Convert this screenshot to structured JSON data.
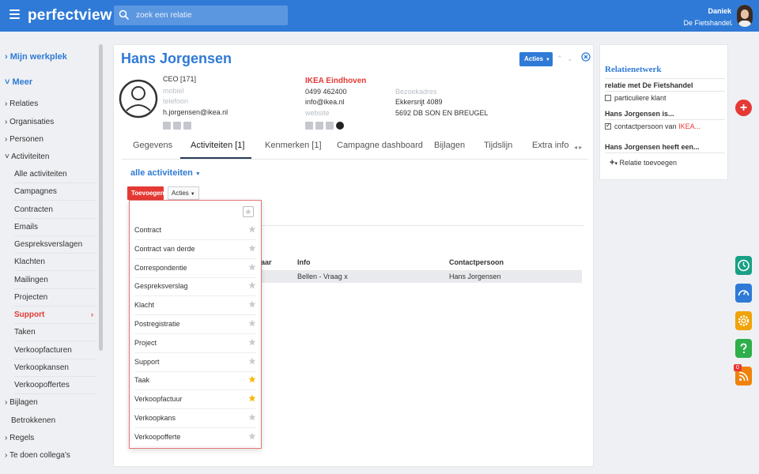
{
  "header": {
    "logo": "perfectview",
    "search_placeholder": "zoek een relatie",
    "user_name": "Daniek",
    "user_org": "De Fietshandel"
  },
  "sidebar": {
    "mijn_werkplek": "Mijn werkplek",
    "meer": "Meer",
    "items": [
      "Relaties",
      "Organisaties",
      "Personen",
      "Activiteiten"
    ],
    "activiteiten_sub": [
      "Alle activiteiten",
      "Campagnes",
      "Contracten",
      "Emails",
      "Gespreksverslagen",
      "Klachten",
      "Mailingen",
      "Projecten",
      "Support",
      "Taken",
      "Verkoopfacturen",
      "Verkoopkansen",
      "Verkoopoffertes"
    ],
    "bottom_items": [
      "Bijlagen",
      "Betrokkenen",
      "Regels",
      "Te doen collega's"
    ]
  },
  "contact": {
    "name": "Hans Jorgensen",
    "acties": "Acties",
    "title": "CEO [171]",
    "mobiel": "mobiel",
    "telefoon": "telefoon",
    "email": "h.jorgensen@ikea.nl",
    "org_name": "IKEA Eindhoven",
    "org_phone": "0499 462400",
    "org_email": "info@ikea.nl",
    "org_website": "website",
    "addr_label": "Bezoekadres",
    "addr_street": "Ekkersrijt 4089",
    "addr_city": "5692 DB SON EN BREUGEL"
  },
  "tabs": [
    "Gegevens",
    "Activiteiten [1]",
    "Kenmerken [1]",
    "Campagne dashboard",
    "Bijlagen",
    "Tijdslijn",
    "Extra info"
  ],
  "activities": {
    "filter": "alle activiteiten",
    "toevoegen": "Toevoegen",
    "acties": "Acties",
    "columns": [
      "aar",
      "Info",
      "Contactpersoon"
    ],
    "row": {
      "info": "Bellen - Vraag x",
      "contact": "Hans Jorgensen"
    }
  },
  "dropdown": {
    "items": [
      {
        "label": "Contract",
        "starred": false
      },
      {
        "label": "Contract van derde",
        "starred": false
      },
      {
        "label": "Correspondentie",
        "starred": false
      },
      {
        "label": "Gespreksverslag",
        "starred": false
      },
      {
        "label": "Klacht",
        "starred": false
      },
      {
        "label": "Postregistratie",
        "starred": false
      },
      {
        "label": "Project",
        "starred": false
      },
      {
        "label": "Support",
        "starred": false
      },
      {
        "label": "Taak",
        "starred": true
      },
      {
        "label": "Verkoopfactuur",
        "starred": true
      },
      {
        "label": "Verkoopkans",
        "starred": false
      },
      {
        "label": "Verkoopofferte",
        "starred": false
      }
    ]
  },
  "relatienetwerk": {
    "title": "Relatienetwerk",
    "relatie_met": "relatie met De Fietshandel",
    "particuliere": "particuliere klant",
    "is_heading": "Hans Jorgensen is...",
    "contactpersoon_van": "contactpersoon van",
    "contact_org": "IKEA...",
    "heeft_heading": "Hans Jorgensen heeft een...",
    "relatie_toevoegen": "Relatie toevoegen"
  },
  "badge_count": "0",
  "colors": {
    "brand": "#2f7ad6",
    "accent": "#e53935"
  }
}
